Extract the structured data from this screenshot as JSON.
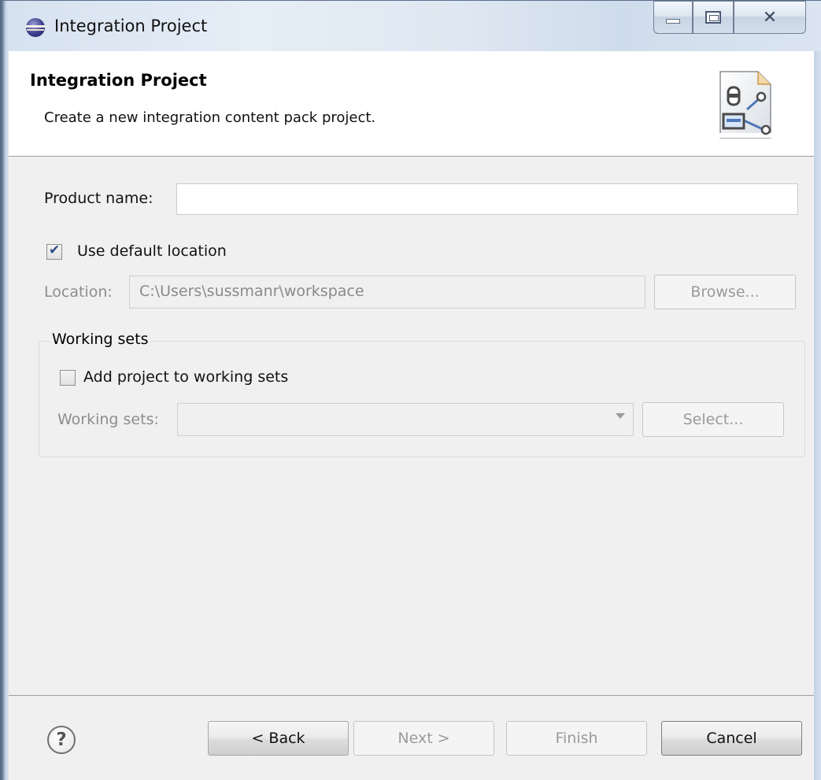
{
  "window": {
    "title": "Integration Project",
    "controls": {
      "minimize": "minimize",
      "maximize": "maximize",
      "close": "close"
    }
  },
  "banner": {
    "title": "Integration Project",
    "description": "Create a new integration content pack project.",
    "icon": "wizard-banner-icon"
  },
  "form": {
    "product_name_label": "Product name:",
    "product_name_value": "",
    "use_default_location_label": "Use default location",
    "use_default_location_checked": true,
    "location_label": "Location:",
    "location_value": "C:\\Users\\sussmanr\\workspace",
    "browse_label": "Browse..."
  },
  "working_sets": {
    "group_label": "Working sets",
    "add_project_label": "Add project to working sets",
    "add_project_checked": false,
    "working_sets_label": "Working sets:",
    "working_sets_value": "",
    "select_label": "Select..."
  },
  "footer": {
    "help_icon": "?",
    "back_label": "< Back",
    "next_label": "Next >",
    "finish_label": "Finish",
    "cancel_label": "Cancel"
  }
}
